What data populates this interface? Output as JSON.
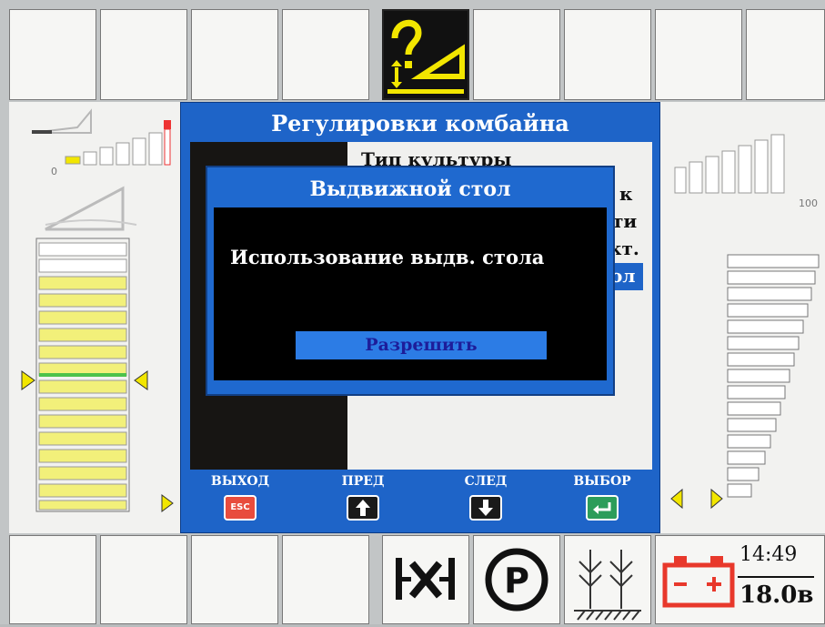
{
  "outer_dialog": {
    "title": "Регулировки комбайна",
    "items": [
      "Тип культуры",
      "к",
      "ти",
      "кт.",
      "ол"
    ]
  },
  "popup": {
    "title": "Выдвижной стол",
    "message": "Использование  выдв. стола",
    "button_label": "Разрешить"
  },
  "footer_buttons": [
    {
      "label": "ВЫХОД",
      "key": "ESC",
      "icon": "esc-key-icon",
      "color": "#e84c3d"
    },
    {
      "label": "ПРЕД",
      "key": "",
      "icon": "arrow-up-icon",
      "color": "#1a1a1a"
    },
    {
      "label": "СЛЕД",
      "key": "",
      "icon": "arrow-down-icon",
      "color": "#1a1a1a"
    },
    {
      "label": "ВЫБОР",
      "key": "",
      "icon": "enter-key-icon",
      "color": "#2c9d5a"
    }
  ],
  "status": {
    "time": "14:49",
    "voltage": "18.0в"
  },
  "gauges": {
    "left_min": "0",
    "right_max": "100"
  },
  "icons": {
    "top_alert": "header-height-warning-icon",
    "bottom": [
      "clutch-icon",
      "parking-brake-icon",
      "crop-field-icon",
      "battery-icon"
    ]
  },
  "colors": {
    "accent_blue": "#1e64c8",
    "warning_yellow": "#f2e600",
    "popup_background": "#000000"
  }
}
